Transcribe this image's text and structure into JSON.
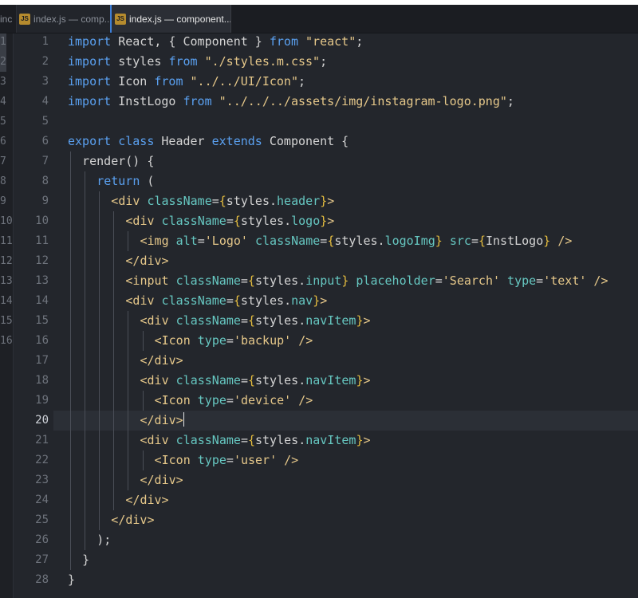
{
  "tabs": [
    {
      "icon": "",
      "prefix": "inc",
      "title": "",
      "active": false
    },
    {
      "icon": "JS",
      "prefix": "",
      "title": "index.js — comp...",
      "active": false
    },
    {
      "icon": "JS",
      "prefix": "",
      "title": "index.js — component...",
      "active": true
    }
  ],
  "left_pane": {
    "line_numbers": [
      "1",
      "2",
      "3",
      "4",
      "5",
      "6",
      "7",
      "8",
      "9",
      "10",
      "11",
      "12",
      "13",
      "14",
      "15",
      "16"
    ]
  },
  "editor": {
    "current_line": 20,
    "line_numbers": [
      "1",
      "2",
      "3",
      "4",
      "5",
      "6",
      "7",
      "8",
      "9",
      "10",
      "11",
      "12",
      "13",
      "14",
      "15",
      "16",
      "17",
      "18",
      "19",
      "20",
      "21",
      "22",
      "23",
      "24",
      "25",
      "26",
      "27",
      "28"
    ],
    "lines": [
      {
        "indent": 0,
        "tokens": [
          [
            "kw",
            "import"
          ],
          [
            "id",
            " React, { Component } "
          ],
          [
            "kw",
            "from"
          ],
          [
            "str",
            " \"react\""
          ],
          [
            "op",
            ";"
          ]
        ]
      },
      {
        "indent": 0,
        "tokens": [
          [
            "kw",
            "import"
          ],
          [
            "id",
            " styles "
          ],
          [
            "kw",
            "from"
          ],
          [
            "str",
            " \"./styles.m.css\""
          ],
          [
            "op",
            ";"
          ]
        ]
      },
      {
        "indent": 0,
        "tokens": [
          [
            "kw",
            "import"
          ],
          [
            "id",
            " Icon "
          ],
          [
            "kw",
            "from"
          ],
          [
            "str",
            " \"../../UI/Icon\""
          ],
          [
            "op",
            ";"
          ]
        ]
      },
      {
        "indent": 0,
        "tokens": [
          [
            "kw",
            "import"
          ],
          [
            "id",
            " InstLogo "
          ],
          [
            "kw",
            "from"
          ],
          [
            "str",
            " \"../../../assets/img/instagram-logo.png\""
          ],
          [
            "op",
            ";"
          ]
        ]
      },
      {
        "indent": 0,
        "tokens": []
      },
      {
        "indent": 0,
        "tokens": [
          [
            "kw",
            "export"
          ],
          [
            "id",
            " "
          ],
          [
            "kw",
            "class"
          ],
          [
            "id",
            " Header "
          ],
          [
            "kw",
            "extends"
          ],
          [
            "id",
            " Component {"
          ]
        ]
      },
      {
        "indent": 1,
        "tokens": [
          [
            "id",
            "render() {"
          ]
        ]
      },
      {
        "indent": 2,
        "tokens": [
          [
            "kw",
            "return"
          ],
          [
            "id",
            " ("
          ]
        ]
      },
      {
        "indent": 3,
        "tokens": [
          [
            "tag",
            "<div"
          ],
          [
            "id",
            " "
          ],
          [
            "prop",
            "className"
          ],
          [
            "op",
            "="
          ],
          [
            "br",
            "{"
          ],
          [
            "id",
            "styles"
          ],
          [
            "op",
            "."
          ],
          [
            "prop",
            "header"
          ],
          [
            "br",
            "}"
          ],
          [
            "tag",
            ">"
          ]
        ]
      },
      {
        "indent": 4,
        "tokens": [
          [
            "tag",
            "<div"
          ],
          [
            "id",
            " "
          ],
          [
            "prop",
            "className"
          ],
          [
            "op",
            "="
          ],
          [
            "br",
            "{"
          ],
          [
            "id",
            "styles"
          ],
          [
            "op",
            "."
          ],
          [
            "prop",
            "logo"
          ],
          [
            "br",
            "}"
          ],
          [
            "tag",
            ">"
          ]
        ]
      },
      {
        "indent": 5,
        "tokens": [
          [
            "tag",
            "<img"
          ],
          [
            "id",
            " "
          ],
          [
            "prop",
            "alt"
          ],
          [
            "op",
            "="
          ],
          [
            "str",
            "'Logo'"
          ],
          [
            "id",
            " "
          ],
          [
            "prop",
            "className"
          ],
          [
            "op",
            "="
          ],
          [
            "br",
            "{"
          ],
          [
            "id",
            "styles"
          ],
          [
            "op",
            "."
          ],
          [
            "prop",
            "logoImg"
          ],
          [
            "br",
            "}"
          ],
          [
            "id",
            " "
          ],
          [
            "prop",
            "src"
          ],
          [
            "op",
            "="
          ],
          [
            "br",
            "{"
          ],
          [
            "id",
            "InstLogo"
          ],
          [
            "br",
            "}"
          ],
          [
            "id",
            " "
          ],
          [
            "tag",
            "/>"
          ]
        ]
      },
      {
        "indent": 4,
        "tokens": [
          [
            "tag",
            "</div>"
          ]
        ]
      },
      {
        "indent": 4,
        "tokens": [
          [
            "tag",
            "<input"
          ],
          [
            "id",
            " "
          ],
          [
            "prop",
            "className"
          ],
          [
            "op",
            "="
          ],
          [
            "br",
            "{"
          ],
          [
            "id",
            "styles"
          ],
          [
            "op",
            "."
          ],
          [
            "prop",
            "input"
          ],
          [
            "br",
            "}"
          ],
          [
            "id",
            " "
          ],
          [
            "prop",
            "placeholder"
          ],
          [
            "op",
            "="
          ],
          [
            "str",
            "'Search'"
          ],
          [
            "id",
            " "
          ],
          [
            "prop",
            "type"
          ],
          [
            "op",
            "="
          ],
          [
            "str",
            "'text'"
          ],
          [
            "id",
            " "
          ],
          [
            "tag",
            "/>"
          ]
        ]
      },
      {
        "indent": 4,
        "tokens": [
          [
            "tag",
            "<div"
          ],
          [
            "id",
            " "
          ],
          [
            "prop",
            "className"
          ],
          [
            "op",
            "="
          ],
          [
            "br",
            "{"
          ],
          [
            "id",
            "styles"
          ],
          [
            "op",
            "."
          ],
          [
            "prop",
            "nav"
          ],
          [
            "br",
            "}"
          ],
          [
            "tag",
            ">"
          ]
        ]
      },
      {
        "indent": 5,
        "tokens": [
          [
            "tag",
            "<div"
          ],
          [
            "id",
            " "
          ],
          [
            "prop",
            "className"
          ],
          [
            "op",
            "="
          ],
          [
            "br",
            "{"
          ],
          [
            "id",
            "styles"
          ],
          [
            "op",
            "."
          ],
          [
            "prop",
            "navItem"
          ],
          [
            "br",
            "}"
          ],
          [
            "tag",
            ">"
          ]
        ]
      },
      {
        "indent": 6,
        "tokens": [
          [
            "tag",
            "<Icon"
          ],
          [
            "id",
            " "
          ],
          [
            "prop",
            "type"
          ],
          [
            "op",
            "="
          ],
          [
            "str",
            "'backup'"
          ],
          [
            "id",
            " "
          ],
          [
            "tag",
            "/>"
          ]
        ]
      },
      {
        "indent": 5,
        "tokens": [
          [
            "tag",
            "</div>"
          ]
        ]
      },
      {
        "indent": 5,
        "tokens": [
          [
            "tag",
            "<div"
          ],
          [
            "id",
            " "
          ],
          [
            "prop",
            "className"
          ],
          [
            "op",
            "="
          ],
          [
            "br",
            "{"
          ],
          [
            "id",
            "styles"
          ],
          [
            "op",
            "."
          ],
          [
            "prop",
            "navItem"
          ],
          [
            "br",
            "}"
          ],
          [
            "tag",
            ">"
          ]
        ]
      },
      {
        "indent": 6,
        "tokens": [
          [
            "tag",
            "<Icon"
          ],
          [
            "id",
            " "
          ],
          [
            "prop",
            "type"
          ],
          [
            "op",
            "="
          ],
          [
            "str",
            "'device'"
          ],
          [
            "id",
            " "
          ],
          [
            "tag",
            "/>"
          ]
        ]
      },
      {
        "indent": 5,
        "tokens": [
          [
            "tag",
            "</div>"
          ]
        ],
        "caret": true
      },
      {
        "indent": 5,
        "tokens": [
          [
            "tag",
            "<div"
          ],
          [
            "id",
            " "
          ],
          [
            "prop",
            "className"
          ],
          [
            "op",
            "="
          ],
          [
            "br",
            "{"
          ],
          [
            "id",
            "styles"
          ],
          [
            "op",
            "."
          ],
          [
            "prop",
            "navItem"
          ],
          [
            "br",
            "}"
          ],
          [
            "tag",
            ">"
          ]
        ]
      },
      {
        "indent": 6,
        "tokens": [
          [
            "tag",
            "<Icon"
          ],
          [
            "id",
            " "
          ],
          [
            "prop",
            "type"
          ],
          [
            "op",
            "="
          ],
          [
            "str",
            "'user'"
          ],
          [
            "id",
            " "
          ],
          [
            "tag",
            "/>"
          ]
        ]
      },
      {
        "indent": 5,
        "tokens": [
          [
            "tag",
            "</div>"
          ]
        ]
      },
      {
        "indent": 4,
        "tokens": [
          [
            "tag",
            "</div>"
          ]
        ]
      },
      {
        "indent": 3,
        "tokens": [
          [
            "tag",
            "</div>"
          ]
        ]
      },
      {
        "indent": 2,
        "tokens": [
          [
            "id",
            ");"
          ]
        ]
      },
      {
        "indent": 1,
        "tokens": [
          [
            "id",
            "}"
          ]
        ]
      },
      {
        "indent": 0,
        "tokens": [
          [
            "id",
            "}"
          ]
        ]
      }
    ]
  },
  "colors": {
    "background": "#23262c",
    "keyword": "#5aa0f0",
    "string": "#e6c88a",
    "attribute": "#66c7c1",
    "brace": "#e5bd3f",
    "active_tab_accent": "#3d7fd9"
  }
}
